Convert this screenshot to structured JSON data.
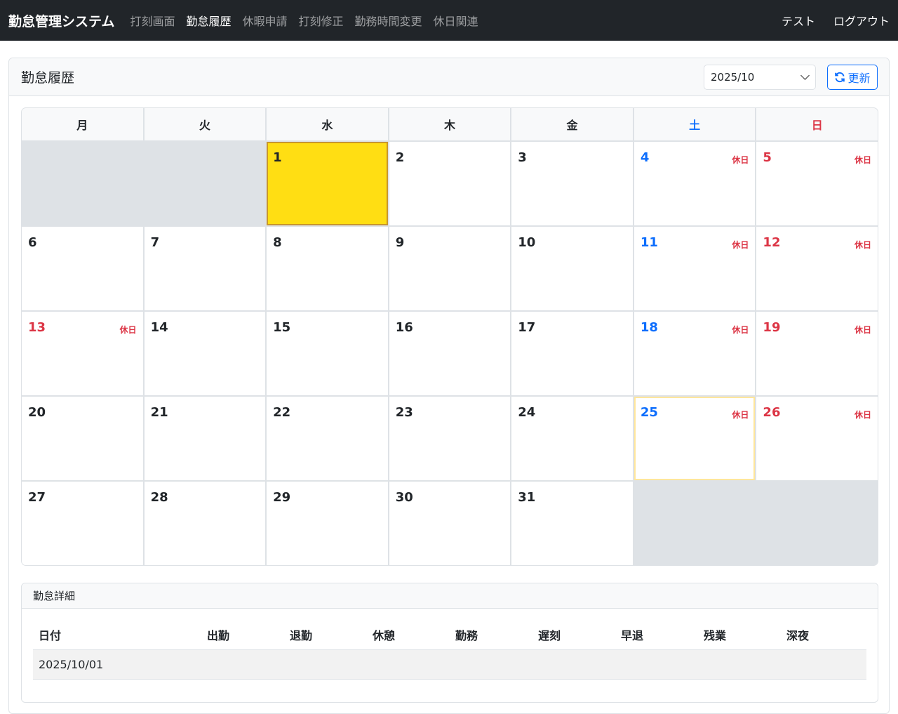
{
  "navbar": {
    "brand": "勤怠管理システム",
    "items": [
      "打刻画面",
      "勤怠履歴",
      "休暇申請",
      "打刻修正",
      "勤務時間変更",
      "休日関連"
    ],
    "active_index": 1,
    "user": "テスト",
    "logout": "ログアウト"
  },
  "page": {
    "title": "勤怠履歴",
    "month_value": "2025/10",
    "refresh_label": "更新"
  },
  "calendar": {
    "weekdays": [
      "月",
      "火",
      "水",
      "木",
      "金",
      "土",
      "日"
    ],
    "holiday_badge": "休日",
    "leading_blanks": 2,
    "days_in_month": 31,
    "holidays": [
      4,
      5,
      11,
      12,
      13,
      18,
      19,
      25,
      26
    ],
    "selected_day": 1,
    "today_day": 25
  },
  "detail": {
    "title": "勤怠詳細",
    "columns": [
      "日付",
      "出勤",
      "退勤",
      "休憩",
      "勤務",
      "遅刻",
      "早退",
      "残業",
      "深夜"
    ],
    "rows": [
      [
        "2025/10/01",
        "",
        "",
        "",
        "",
        "",
        "",
        "",
        ""
      ]
    ]
  },
  "colors": {
    "navbar_bg": "#212529",
    "primary": "#0d6efd",
    "danger": "#dc3545",
    "selected": "#ffde13"
  }
}
